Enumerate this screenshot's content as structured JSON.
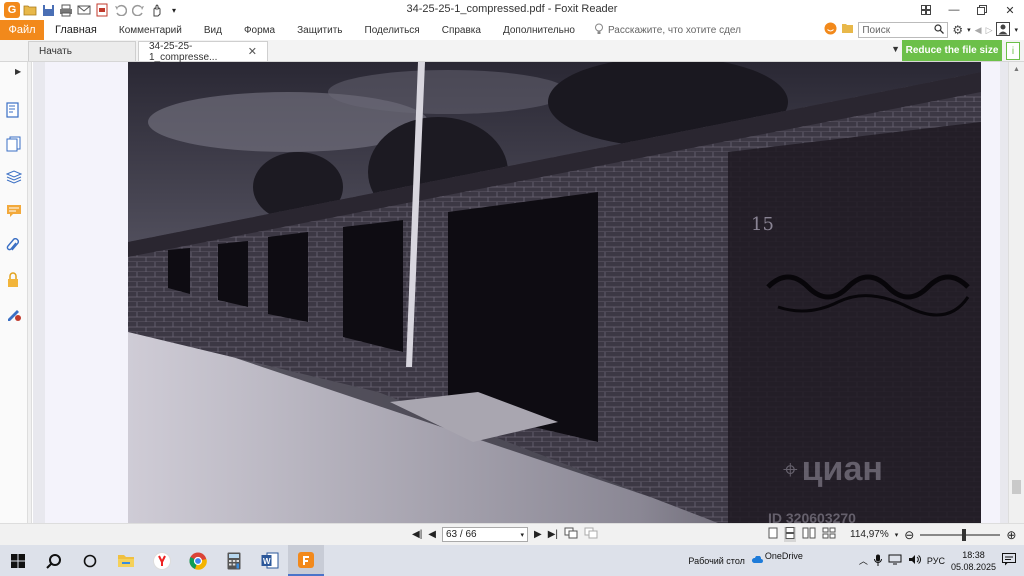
{
  "window": {
    "title": "34-25-25-1_compressed.pdf - Foxit Reader"
  },
  "ribbon": {
    "file_label": "Файл",
    "menus": [
      "Главная",
      "Комментарий",
      "Вид",
      "Форма",
      "Защитить",
      "Поделиться",
      "Справка",
      "Дополнительно"
    ],
    "tell_me": "Расскажите, что хотите сдел",
    "search_placeholder": "Поиск"
  },
  "tabs": {
    "start": "Начать",
    "document": "34-25-25-1_compresse..."
  },
  "promo": {
    "reduce_label": "Reduce the file size"
  },
  "document": {
    "photo_number": "15",
    "watermark_brand": "циан",
    "watermark_id": "ID 320603270"
  },
  "statusbar": {
    "page_indicator": "63 / 66",
    "zoom_level": "114,97%"
  },
  "taskbar": {
    "desktop_label": "Рабочий стол",
    "onedrive_label": "OneDrive",
    "language": "РУС",
    "time": "18:38",
    "date": "05.08.2025"
  },
  "colors": {
    "accent": "#f2891b",
    "promo": "#6cc049",
    "taskbar": "#dde1ea"
  }
}
